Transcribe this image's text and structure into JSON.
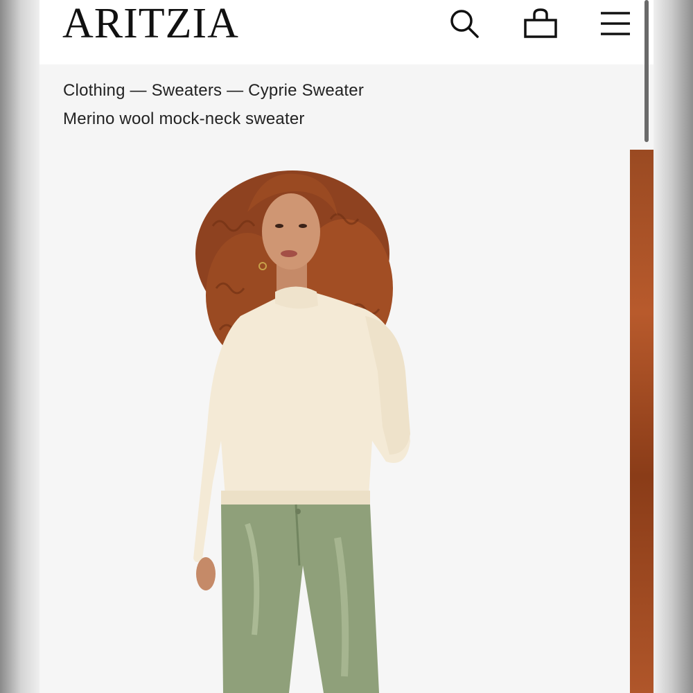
{
  "brand": {
    "logo_text": "ARITZIA"
  },
  "header": {
    "icons": [
      "search-icon",
      "shopping-bag-icon",
      "menu-icon"
    ]
  },
  "breadcrumb": {
    "items": [
      "Clothing",
      "Sweaters",
      "Cyprie Sweater"
    ],
    "separator": "—",
    "text": "Clothing — Sweaters — Cyprie Sweater"
  },
  "product": {
    "subtitle": "Merino wool mock-neck sweater"
  },
  "colors": {
    "sweater": "#f4ead6",
    "pants": "#8fa07a",
    "hair": "#9a4a22",
    "background": "#f6f6f6"
  }
}
